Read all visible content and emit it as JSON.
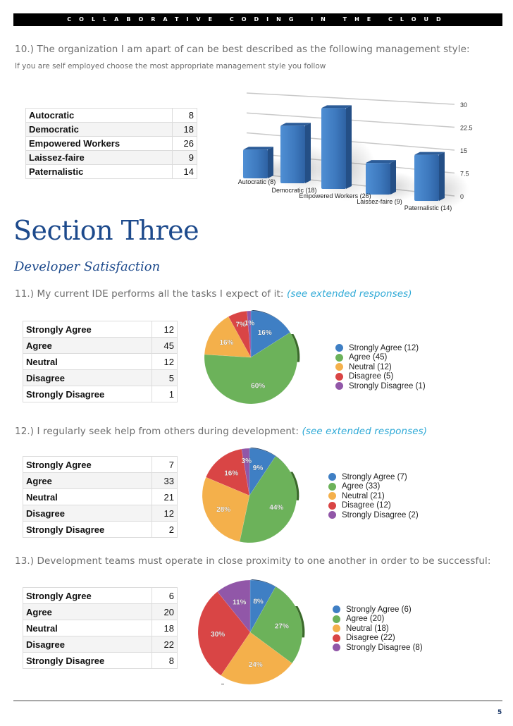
{
  "header": {
    "title": "COLLABORATIVE CODING IN THE CLOUD"
  },
  "q10": {
    "title": "10.) The organization I am apart of can be best described as the following management style:",
    "subtitle": "If you are self employed choose the most appropriate management style you follow",
    "rows": [
      {
        "label": "Autocratic",
        "value": "8"
      },
      {
        "label": "Democratic",
        "value": "18"
      },
      {
        "label": "Empowered Workers",
        "value": "26"
      },
      {
        "label": "Laissez-faire",
        "value": "9"
      },
      {
        "label": "Paternalistic",
        "value": "14"
      }
    ]
  },
  "section": {
    "title": "Section Three",
    "subtitle": "Developer Satisfaction"
  },
  "q11": {
    "title": "11.) My current IDE performs all the tasks I expect of it:",
    "link": "(see extended responses)",
    "rows": [
      {
        "label": "Strongly Agree",
        "value": "12"
      },
      {
        "label": "Agree",
        "value": "45"
      },
      {
        "label": "Neutral",
        "value": "12"
      },
      {
        "label": "Disagree",
        "value": "5"
      },
      {
        "label": "Strongly Disagree",
        "value": "1"
      }
    ]
  },
  "q12": {
    "title": "12.) I regularly seek help from others during development:",
    "link": "(see extended responses)",
    "rows": [
      {
        "label": "Strongly Agree",
        "value": "7"
      },
      {
        "label": "Agree",
        "value": "33"
      },
      {
        "label": "Neutral",
        "value": "21"
      },
      {
        "label": "Disagree",
        "value": "12"
      },
      {
        "label": "Strongly Disagree",
        "value": "2"
      }
    ]
  },
  "q13": {
    "title": "13.) Development teams must operate in close proximity to one another in order to be successful:",
    "rows": [
      {
        "label": "Strongly Agree",
        "value": "6"
      },
      {
        "label": "Agree",
        "value": "20"
      },
      {
        "label": "Neutral",
        "value": "18"
      },
      {
        "label": "Disagree",
        "value": "22"
      },
      {
        "label": "Strongly Disagree",
        "value": "8"
      }
    ]
  },
  "colors": {
    "strongly_agree": "#3f7fc4",
    "agree": "#6cb25a",
    "neutral": "#f4b04b",
    "disagree": "#d94545",
    "strongly_disagree": "#9157a8",
    "bar": "#3d78bd",
    "heading": "#1d4a8c",
    "link": "#2ea9d6"
  },
  "footer": {
    "page_number": "5"
  },
  "chart_data": [
    {
      "type": "bar",
      "title": "",
      "categories": [
        "Autocratic (8)",
        "Democratic (18)",
        "Empowered Workers (26)",
        "Laissez-faire (9)",
        "Paternalistic (14)"
      ],
      "values": [
        8,
        18,
        26,
        9,
        14
      ],
      "yticks": [
        "0",
        "7.5",
        "15",
        "22.5",
        "30"
      ],
      "ylim": [
        0,
        30
      ],
      "grid": true,
      "xlabel": "",
      "ylabel": ""
    },
    {
      "type": "pie",
      "labels": [
        "Strongly Agree",
        "Agree",
        "Neutral",
        "Disagree",
        "Strongly Disagree"
      ],
      "values": [
        12,
        45,
        12,
        5,
        1
      ],
      "percent_labels": [
        "16%",
        "60%",
        "16%",
        "7%",
        "1%"
      ],
      "legend": [
        "Strongly Agree (12)",
        "Agree (45)",
        "Neutral (12)",
        "Disagree (5)",
        "Strongly Disagree (1)"
      ],
      "legend_position": "right"
    },
    {
      "type": "pie",
      "labels": [
        "Strongly Agree",
        "Agree",
        "Neutral",
        "Disagree",
        "Strongly Disagree"
      ],
      "values": [
        7,
        33,
        21,
        12,
        2
      ],
      "percent_labels": [
        "9%",
        "44%",
        "28%",
        "16%",
        "3%"
      ],
      "legend": [
        "Strongly Agree (7)",
        "Agree (33)",
        "Neutral (21)",
        "Disagree (12)",
        "Strongly Disagree (2)"
      ],
      "legend_position": "right"
    },
    {
      "type": "pie",
      "labels": [
        "Strongly Agree",
        "Agree",
        "Neutral",
        "Disagree",
        "Strongly Disagree"
      ],
      "values": [
        6,
        20,
        18,
        22,
        8
      ],
      "percent_labels": [
        "8%",
        "27%",
        "24%",
        "30%",
        "11%"
      ],
      "legend": [
        "Strongly Agree (6)",
        "Agree (20)",
        "Neutral (18)",
        "Disagree (22)",
        "Strongly Disagree (8)"
      ],
      "legend_position": "right"
    }
  ]
}
